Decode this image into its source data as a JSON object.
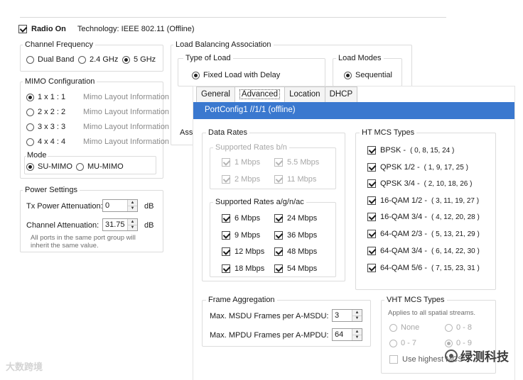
{
  "radio_on": {
    "label": "Radio On",
    "checked": true,
    "technology": "Technology: IEEE 802.11 (Offline)"
  },
  "channel_frequency": {
    "title": "Channel Frequency",
    "options": [
      {
        "label": "Dual Band",
        "selected": false
      },
      {
        "label": "2.4 GHz",
        "selected": false
      },
      {
        "label": "5 GHz",
        "selected": true
      }
    ]
  },
  "mimo": {
    "title": "MIMO Configuration",
    "options": [
      {
        "label": "1 x 1 : 1",
        "info": "Mimo Layout Information",
        "selected": true
      },
      {
        "label": "2 x 2 : 2",
        "info": "Mimo Layout Information",
        "selected": false
      },
      {
        "label": "3 x 3 : 3",
        "info": "Mimo Layout Information",
        "selected": false
      },
      {
        "label": "4 x 4 : 4",
        "info": "Mimo Layout Information",
        "selected": false
      }
    ],
    "mode": {
      "title": "Mode",
      "options": [
        {
          "label": "SU-MIMO",
          "selected": true
        },
        {
          "label": "MU-MIMO",
          "selected": false
        }
      ]
    }
  },
  "power": {
    "title": "Power Settings",
    "tx_label": "Tx Power Attenuation:",
    "tx_value": "0",
    "tx_unit": "dB",
    "ch_label": "Channel Attenuation:",
    "ch_value": "31.75",
    "ch_unit": "dB",
    "note": "All ports in the same port group will inherit the same value."
  },
  "load_balancing": {
    "title": "Load Balancing Association",
    "type_title": "Type of Load",
    "type_option": "Fixed Load with Delay",
    "modes_title": "Load Modes",
    "modes_option": "Sequential",
    "assoc_label": "Asso"
  },
  "tabs": [
    {
      "label": "General",
      "active": false
    },
    {
      "label": "Advanced",
      "active": true
    },
    {
      "label": "Location",
      "active": false
    },
    {
      "label": "DHCP",
      "active": false
    }
  ],
  "port_config": "PortConfig1 //1/1 (offline)",
  "data_rates": {
    "title": "Data Rates",
    "bn_title": "Supported Rates b/n",
    "bn_rates": [
      {
        "label": "1 Mbps",
        "checked": true
      },
      {
        "label": "5.5 Mbps",
        "checked": true
      },
      {
        "label": "2 Mbps",
        "checked": true
      },
      {
        "label": "11 Mbps",
        "checked": true
      }
    ],
    "agnac_title": "Supported Rates a/g/n/ac",
    "agnac_rates": [
      {
        "label": "6 Mbps",
        "checked": true
      },
      {
        "label": "24 Mbps",
        "checked": true
      },
      {
        "label": "9 Mbps",
        "checked": true
      },
      {
        "label": "36 Mbps",
        "checked": true
      },
      {
        "label": "12 Mbps",
        "checked": true
      },
      {
        "label": "48 Mbps",
        "checked": true
      },
      {
        "label": "18 Mbps",
        "checked": true
      },
      {
        "label": "54 Mbps",
        "checked": true
      }
    ]
  },
  "ht_mcs": {
    "title": "HT MCS Types",
    "items": [
      {
        "label": "BPSK -",
        "values": "( 0, 8, 15, 24 )",
        "checked": true
      },
      {
        "label": "QPSK 1/2 -",
        "values": "( 1, 9, 17, 25 )",
        "checked": true
      },
      {
        "label": "QPSK 3/4 -",
        "values": "( 2, 10, 18, 26 )",
        "checked": true
      },
      {
        "label": "16-QAM 1/2 -",
        "values": "( 3, 11, 19, 27 )",
        "checked": true
      },
      {
        "label": "16-QAM 3/4 -",
        "values": "( 4, 12, 20, 28 )",
        "checked": true
      },
      {
        "label": "64-QAM 2/3 -",
        "values": "( 5, 13, 21, 29 )",
        "checked": true
      },
      {
        "label": "64-QAM 3/4 -",
        "values": "( 6, 14, 22, 30 )",
        "checked": true
      },
      {
        "label": "64-QAM 5/6 -",
        "values": "( 7, 15, 23, 31 )",
        "checked": true
      }
    ]
  },
  "frame_agg": {
    "title": "Frame Aggregation",
    "msdu_label": "Max. MSDU Frames per A-MSDU:",
    "msdu_value": "3",
    "mpdu_label": "Max. MPDU Frames per A-MPDU:",
    "mpdu_value": "64"
  },
  "vht_mcs": {
    "title": "VHT MCS Types",
    "note": "Applies to all spatial streams.",
    "options": [
      {
        "label": "None",
        "selected": false
      },
      {
        "label": "0 - 8",
        "selected": false
      },
      {
        "label": "0 - 7",
        "selected": false
      },
      {
        "label": "0 - 9",
        "selected": true
      }
    ],
    "use_highest": "Use highest MCS"
  },
  "watermark": {
    "right": "绿测科技",
    "left": "大数跨境"
  }
}
